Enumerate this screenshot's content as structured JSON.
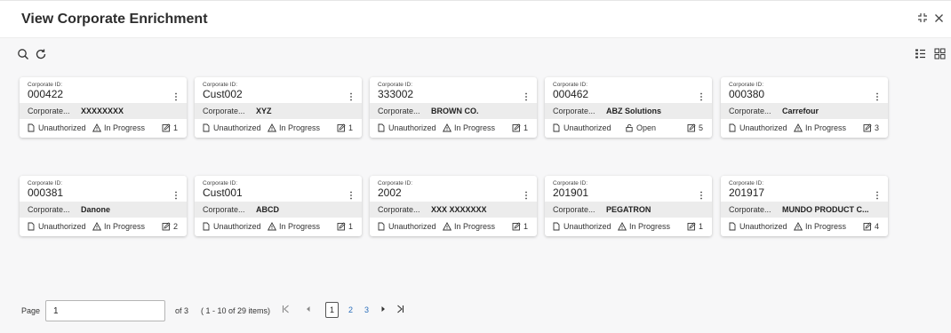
{
  "window": {
    "title": "View Corporate Enrichment"
  },
  "toolbar": {
    "icons": [
      "search-icon",
      "refresh-icon"
    ],
    "view_icons": [
      "list-view-icon",
      "grid-view-icon"
    ]
  },
  "cards": [
    {
      "id_label": "Corporate ID:",
      "id": "000422",
      "name_label": "Corporate...",
      "name": "XXXXXXXX",
      "auth": "Unauthorized",
      "status": "In Progress",
      "status_icon": "warning-icon",
      "count": "1"
    },
    {
      "id_label": "Corporate ID:",
      "id": "Cust002",
      "name_label": "Corporate...",
      "name": "XYZ",
      "auth": "Unauthorized",
      "status": "In Progress",
      "status_icon": "warning-icon",
      "count": "1"
    },
    {
      "id_label": "Corporate ID:",
      "id": "333002",
      "name_label": "Corporate...",
      "name": "BROWN CO.",
      "auth": "Unauthorized",
      "status": "In Progress",
      "status_icon": "warning-icon",
      "count": "1"
    },
    {
      "id_label": "Corporate ID:",
      "id": "000462",
      "name_label": "Corporate...",
      "name": "ABZ Solutions",
      "auth": "Unauthorized",
      "status": "Open",
      "status_icon": "unlock-icon",
      "count": "5"
    },
    {
      "id_label": "Corporate ID:",
      "id": "000380",
      "name_label": "Corporate...",
      "name": "Carrefour",
      "auth": "Unauthorized",
      "status": "In Progress",
      "status_icon": "warning-icon",
      "count": "3"
    },
    {
      "id_label": "Corporate ID:",
      "id": "000381",
      "name_label": "Corporate...",
      "name": "Danone",
      "auth": "Unauthorized",
      "status": "In Progress",
      "status_icon": "warning-icon",
      "count": "2"
    },
    {
      "id_label": "Corporate ID:",
      "id": "Cust001",
      "name_label": "Corporate...",
      "name": "ABCD",
      "auth": "Unauthorized",
      "status": "In Progress",
      "status_icon": "warning-icon",
      "count": "1"
    },
    {
      "id_label": "Corporate ID:",
      "id": "2002",
      "name_label": "Corporate...",
      "name": "XXX XXXXXXX",
      "auth": "Unauthorized",
      "status": "In Progress",
      "status_icon": "warning-icon",
      "count": "1"
    },
    {
      "id_label": "Corporate ID:",
      "id": "201901",
      "name_label": "Corporate...",
      "name": "PEGATRON",
      "auth": "Unauthorized",
      "status": "In Progress",
      "status_icon": "warning-icon",
      "count": "1"
    },
    {
      "id_label": "Corporate ID:",
      "id": "201917",
      "name_label": "Corporate...",
      "name": "MUNDO PRODUCT C...",
      "auth": "Unauthorized",
      "status": "In Progress",
      "status_icon": "warning-icon",
      "count": "4"
    }
  ],
  "pagination": {
    "page_label": "Page",
    "page_value": "1",
    "of_text": "of 3",
    "range_text": "( 1 - 10 of 29 items)",
    "first_icon": "first-page-icon",
    "prev_icon": "prev-page-icon",
    "pages": [
      "1",
      "2",
      "3"
    ],
    "current_page": "1",
    "next_icon": "next-page-icon",
    "last_icon": "last-page-icon"
  },
  "colors": {
    "background": "#f7f7f8",
    "card": "#ffffff",
    "card_band": "#ececec",
    "link": "#2a6ebb"
  }
}
